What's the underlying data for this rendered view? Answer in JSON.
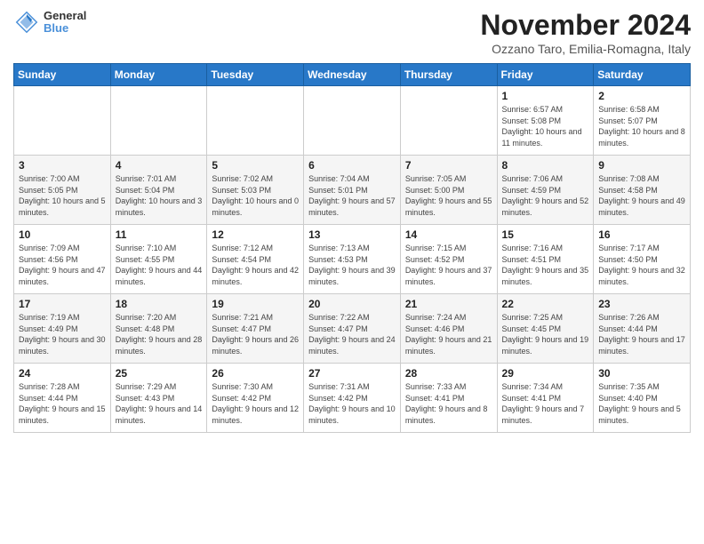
{
  "header": {
    "logo_line1": "General",
    "logo_line2": "Blue",
    "month_title": "November 2024",
    "location": "Ozzano Taro, Emilia-Romagna, Italy"
  },
  "days_header": [
    "Sunday",
    "Monday",
    "Tuesday",
    "Wednesday",
    "Thursday",
    "Friday",
    "Saturday"
  ],
  "weeks": [
    [
      {
        "day": "",
        "info": ""
      },
      {
        "day": "",
        "info": ""
      },
      {
        "day": "",
        "info": ""
      },
      {
        "day": "",
        "info": ""
      },
      {
        "day": "",
        "info": ""
      },
      {
        "day": "1",
        "info": "Sunrise: 6:57 AM\nSunset: 5:08 PM\nDaylight: 10 hours and 11 minutes."
      },
      {
        "day": "2",
        "info": "Sunrise: 6:58 AM\nSunset: 5:07 PM\nDaylight: 10 hours and 8 minutes."
      }
    ],
    [
      {
        "day": "3",
        "info": "Sunrise: 7:00 AM\nSunset: 5:05 PM\nDaylight: 10 hours and 5 minutes."
      },
      {
        "day": "4",
        "info": "Sunrise: 7:01 AM\nSunset: 5:04 PM\nDaylight: 10 hours and 3 minutes."
      },
      {
        "day": "5",
        "info": "Sunrise: 7:02 AM\nSunset: 5:03 PM\nDaylight: 10 hours and 0 minutes."
      },
      {
        "day": "6",
        "info": "Sunrise: 7:04 AM\nSunset: 5:01 PM\nDaylight: 9 hours and 57 minutes."
      },
      {
        "day": "7",
        "info": "Sunrise: 7:05 AM\nSunset: 5:00 PM\nDaylight: 9 hours and 55 minutes."
      },
      {
        "day": "8",
        "info": "Sunrise: 7:06 AM\nSunset: 4:59 PM\nDaylight: 9 hours and 52 minutes."
      },
      {
        "day": "9",
        "info": "Sunrise: 7:08 AM\nSunset: 4:58 PM\nDaylight: 9 hours and 49 minutes."
      }
    ],
    [
      {
        "day": "10",
        "info": "Sunrise: 7:09 AM\nSunset: 4:56 PM\nDaylight: 9 hours and 47 minutes."
      },
      {
        "day": "11",
        "info": "Sunrise: 7:10 AM\nSunset: 4:55 PM\nDaylight: 9 hours and 44 minutes."
      },
      {
        "day": "12",
        "info": "Sunrise: 7:12 AM\nSunset: 4:54 PM\nDaylight: 9 hours and 42 minutes."
      },
      {
        "day": "13",
        "info": "Sunrise: 7:13 AM\nSunset: 4:53 PM\nDaylight: 9 hours and 39 minutes."
      },
      {
        "day": "14",
        "info": "Sunrise: 7:15 AM\nSunset: 4:52 PM\nDaylight: 9 hours and 37 minutes."
      },
      {
        "day": "15",
        "info": "Sunrise: 7:16 AM\nSunset: 4:51 PM\nDaylight: 9 hours and 35 minutes."
      },
      {
        "day": "16",
        "info": "Sunrise: 7:17 AM\nSunset: 4:50 PM\nDaylight: 9 hours and 32 minutes."
      }
    ],
    [
      {
        "day": "17",
        "info": "Sunrise: 7:19 AM\nSunset: 4:49 PM\nDaylight: 9 hours and 30 minutes."
      },
      {
        "day": "18",
        "info": "Sunrise: 7:20 AM\nSunset: 4:48 PM\nDaylight: 9 hours and 28 minutes."
      },
      {
        "day": "19",
        "info": "Sunrise: 7:21 AM\nSunset: 4:47 PM\nDaylight: 9 hours and 26 minutes."
      },
      {
        "day": "20",
        "info": "Sunrise: 7:22 AM\nSunset: 4:47 PM\nDaylight: 9 hours and 24 minutes."
      },
      {
        "day": "21",
        "info": "Sunrise: 7:24 AM\nSunset: 4:46 PM\nDaylight: 9 hours and 21 minutes."
      },
      {
        "day": "22",
        "info": "Sunrise: 7:25 AM\nSunset: 4:45 PM\nDaylight: 9 hours and 19 minutes."
      },
      {
        "day": "23",
        "info": "Sunrise: 7:26 AM\nSunset: 4:44 PM\nDaylight: 9 hours and 17 minutes."
      }
    ],
    [
      {
        "day": "24",
        "info": "Sunrise: 7:28 AM\nSunset: 4:44 PM\nDaylight: 9 hours and 15 minutes."
      },
      {
        "day": "25",
        "info": "Sunrise: 7:29 AM\nSunset: 4:43 PM\nDaylight: 9 hours and 14 minutes."
      },
      {
        "day": "26",
        "info": "Sunrise: 7:30 AM\nSunset: 4:42 PM\nDaylight: 9 hours and 12 minutes."
      },
      {
        "day": "27",
        "info": "Sunrise: 7:31 AM\nSunset: 4:42 PM\nDaylight: 9 hours and 10 minutes."
      },
      {
        "day": "28",
        "info": "Sunrise: 7:33 AM\nSunset: 4:41 PM\nDaylight: 9 hours and 8 minutes."
      },
      {
        "day": "29",
        "info": "Sunrise: 7:34 AM\nSunset: 4:41 PM\nDaylight: 9 hours and 7 minutes."
      },
      {
        "day": "30",
        "info": "Sunrise: 7:35 AM\nSunset: 4:40 PM\nDaylight: 9 hours and 5 minutes."
      }
    ]
  ]
}
